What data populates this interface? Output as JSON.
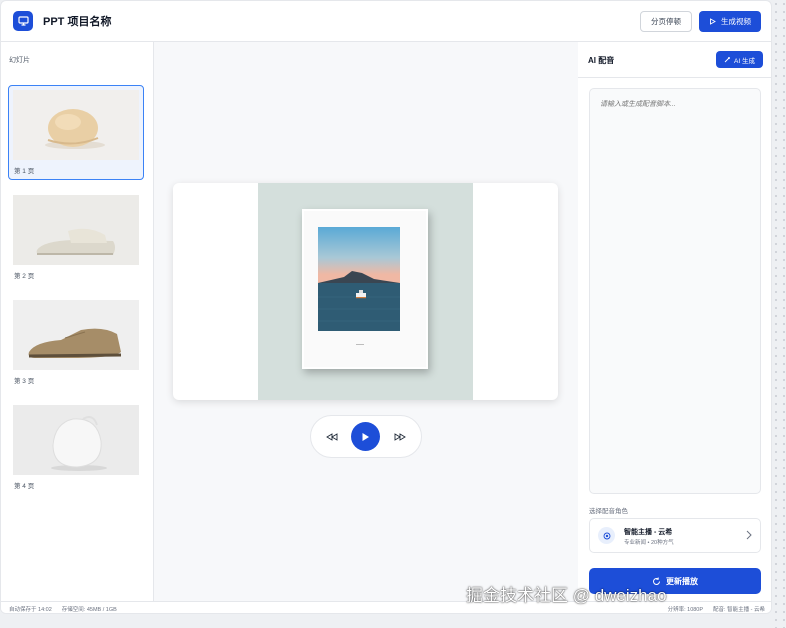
{
  "header": {
    "title": "PPT 项目名称",
    "share_label": "分页停顿",
    "generate_label": "生成视频"
  },
  "sidebar": {
    "title": "幻灯片",
    "slides": [
      {
        "label": "第 1 页"
      },
      {
        "label": "第 2 页"
      },
      {
        "label": "第 3 页"
      },
      {
        "label": "第 4 页"
      }
    ]
  },
  "panel": {
    "title": "AI 配音",
    "ai_button_label": "AI 生成",
    "script_placeholder": "请输入或生成配音脚本...",
    "voice_section_label": "选择配音角色",
    "voice_name": "智能主播 - 云希",
    "voice_desc": "专业新闻 • 20种方气",
    "update_label": "更新播放"
  },
  "status": {
    "autosave": "自动保存于 14:02",
    "storage": "存储空间: 45MB / 1GB",
    "resolution": "分辨率: 1080P",
    "voice": "配音: 智能主播 - 云希"
  },
  "watermark": "掘金技术社区 @ dweizhao",
  "colors": {
    "accent": "#1d4ed8",
    "active_border": "#3b82f6"
  }
}
